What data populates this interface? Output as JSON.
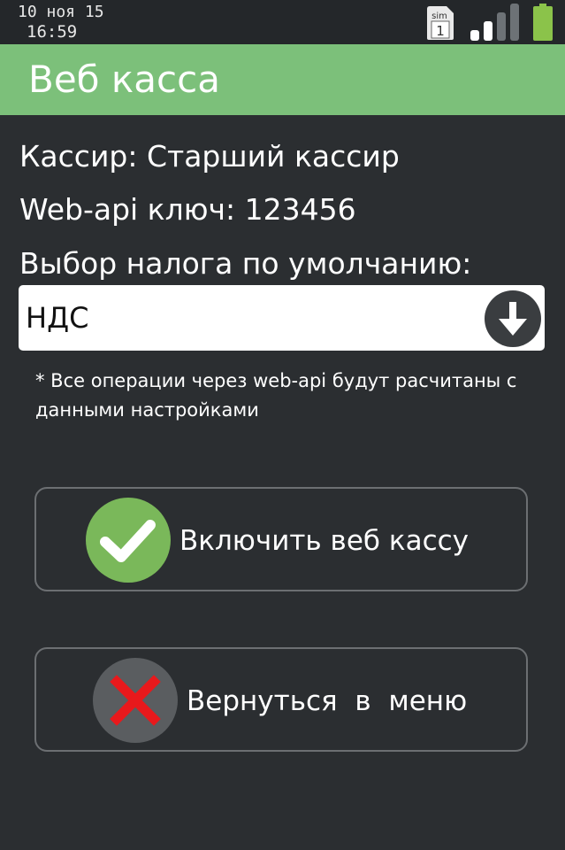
{
  "status_bar": {
    "date": "10 ноя 15",
    "time": "16:59",
    "sim_label": "sim",
    "sim_number": "1",
    "icons": [
      "sim-card-icon",
      "signal-strength-icon",
      "battery-icon"
    ]
  },
  "header": {
    "title": "Веб касса",
    "color": "#7cc07a"
  },
  "info": {
    "cashier": "Кассир: Старший кассир",
    "api_key": "Web-api ключ: 123456",
    "tax_label": "Выбор налога по умолчанию:"
  },
  "tax_select": {
    "value": "НДС",
    "icon": "arrow-down-circle-icon"
  },
  "note": "* Все операции через web-api будут расчитаны с данными настройками",
  "buttons": {
    "enable": {
      "label": "Включить веб кассу",
      "icon": "checkmark-icon",
      "icon_color": "#7ab85a"
    },
    "back": {
      "label": "Вернуться  в  меню",
      "icon": "close-x-icon",
      "icon_color": "#e8191c"
    }
  }
}
